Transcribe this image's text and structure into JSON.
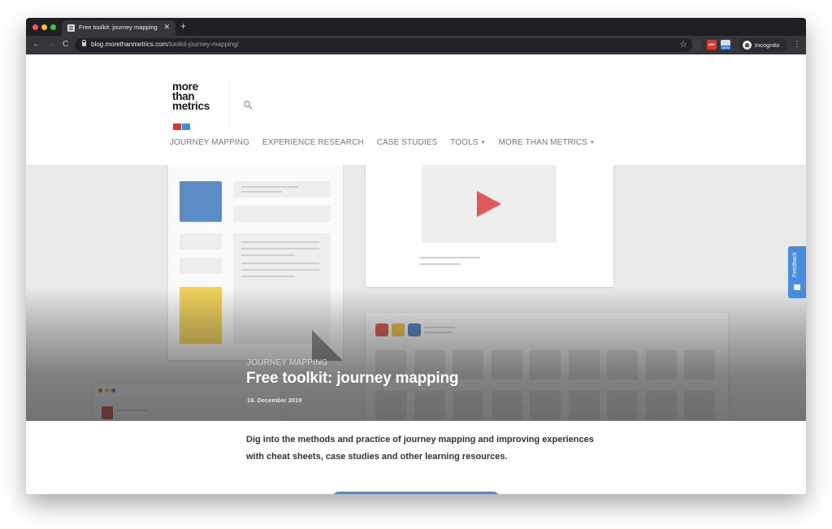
{
  "browser": {
    "tab": {
      "title": "Free toolkit: journey mapping",
      "close": "✕"
    },
    "new_tab": "+",
    "nav": {
      "back": "←",
      "forward": "→",
      "reload": "C"
    },
    "url": {
      "host": "blog.morethanmetrics.com",
      "path": "/toolkit-journey-mapping/"
    },
    "extensions": {
      "abp": "ABP",
      "new": "NEW"
    },
    "profile": {
      "label": "Incognito"
    },
    "menu": "⋮",
    "star": "☆"
  },
  "site": {
    "logo": {
      "line1": "more",
      "line2": "than",
      "line3": "metrics"
    },
    "nav": [
      {
        "label": "JOURNEY MAPPING",
        "dropdown": false
      },
      {
        "label": "EXPERIENCE RESEARCH",
        "dropdown": false
      },
      {
        "label": "CASE STUDIES",
        "dropdown": false
      },
      {
        "label": "TOOLS",
        "dropdown": true
      },
      {
        "label": "MORE THAN METRICS",
        "dropdown": true
      }
    ],
    "caret": "▼"
  },
  "hero": {
    "category": "JOURNEY MAPPING",
    "title": "Free toolkit: journey mapping",
    "date": "19. December 2019",
    "colors": {
      "blue": "#5c8bc6",
      "yellow": "#f1d15b",
      "red": "#e25a5a"
    }
  },
  "feedback": {
    "label": "Feedback"
  },
  "article": {
    "intro": "Dig into the methods and practice of journey mapping and improving experiences with cheat sheets, case studies and other learning resources."
  },
  "colors": {
    "accent": "#4a8ad8",
    "feedback": "#4a8ce0"
  }
}
